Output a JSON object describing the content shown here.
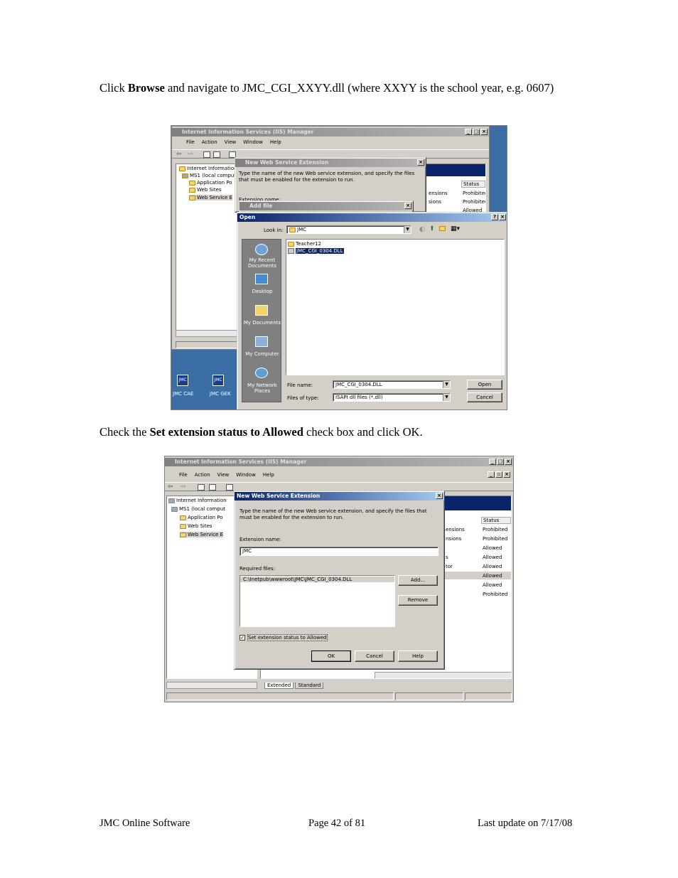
{
  "instructions": {
    "step1": {
      "prefix": "Click ",
      "bold": "Browse",
      "suffix": " and navigate to JMC_CGI_XXYY.dll (where XXYY is the school year, e.g. 0607)"
    },
    "step2": {
      "prefix": "Check the ",
      "bold": "Set extension status to Allowed",
      "suffix": " check box and click OK."
    }
  },
  "footer": {
    "left": "JMC Online Software",
    "center": "Page 42 of 81",
    "right": "Last update on 7/17/08"
  },
  "shot1": {
    "iis": {
      "title": "Internet Information Services (IIS) Manager",
      "menu": [
        "File",
        "Action",
        "View",
        "Window",
        "Help"
      ],
      "tree": [
        "Internet Information",
        "MS1 (local comput",
        "Application Po",
        "Web Sites",
        "Web Service E"
      ],
      "right_header": "Status",
      "right_rows": [
        {
          "name": "ensions",
          "status": "Prohibited"
        },
        {
          "name": "sions",
          "status": "Prohibited"
        },
        {
          "name": "",
          "status": "Allowed"
        }
      ]
    },
    "nwse": {
      "title": "New Web Service Extension",
      "desc": "Type the name of the new Web service extension, and specify the files that must be enabled for the extension to run.",
      "ext_label": "Extension name:"
    },
    "addfile": {
      "title": "Add file"
    },
    "open": {
      "title": "Open",
      "lookin_label": "Look in:",
      "lookin_value": "JMC",
      "places": [
        "My Recent Documents",
        "Desktop",
        "My Documents",
        "My Computer",
        "My Network Places"
      ],
      "files": [
        "Teacher12",
        "JMC_CGI_0304.DLL"
      ],
      "filename_label": "File name:",
      "filename_value": "JMC_CGI_0304.DLL",
      "filetype_label": "Files of type:",
      "filetype_value": "ISAPI dll files (*.dll)",
      "open_btn": "Open",
      "cancel_btn": "Cancel"
    },
    "desktop_icons": [
      "JMC CAE",
      "JMC GEK"
    ]
  },
  "shot2": {
    "iis": {
      "title": "Internet Information Services (IIS) Manager",
      "menu": [
        "File",
        "Action",
        "View",
        "Window",
        "Help"
      ],
      "tree": [
        "Internet Information",
        "MS1 (local comput",
        "Application Po",
        "Web Sites",
        "Web Service E"
      ],
      "right_header": "Status",
      "right_rows": [
        {
          "name": "ensions",
          "status": "Prohibited"
        },
        {
          "name": "nsions",
          "status": "Prohibited"
        },
        {
          "name": "",
          "status": "Allowed"
        },
        {
          "name": "s",
          "status": "Allowed"
        },
        {
          "name": "tor",
          "status": "Allowed"
        },
        {
          "name": "",
          "status": "Allowed"
        },
        {
          "name": "",
          "status": "Allowed"
        },
        {
          "name": "",
          "status": "Prohibited"
        }
      ],
      "tabs": [
        "Extended",
        "Standard"
      ]
    },
    "nwse": {
      "title": "New Web Service Extension",
      "desc": "Type the name of the new Web service extension, and specify the files that must be enabled for the extension to run.",
      "ext_label": "Extension name:",
      "ext_value": "JMC",
      "req_label": "Required files:",
      "req_file": "C:\\Inetpub\\wwwroot\\JMC\\JMC_CGI_0304.DLL",
      "add_btn": "Add...",
      "remove_btn": "Remove",
      "checkbox_label": "Set extension status to Allowed",
      "checkbox_checked": true,
      "ok_btn": "OK",
      "cancel_btn": "Cancel",
      "help_btn": "Help"
    }
  }
}
